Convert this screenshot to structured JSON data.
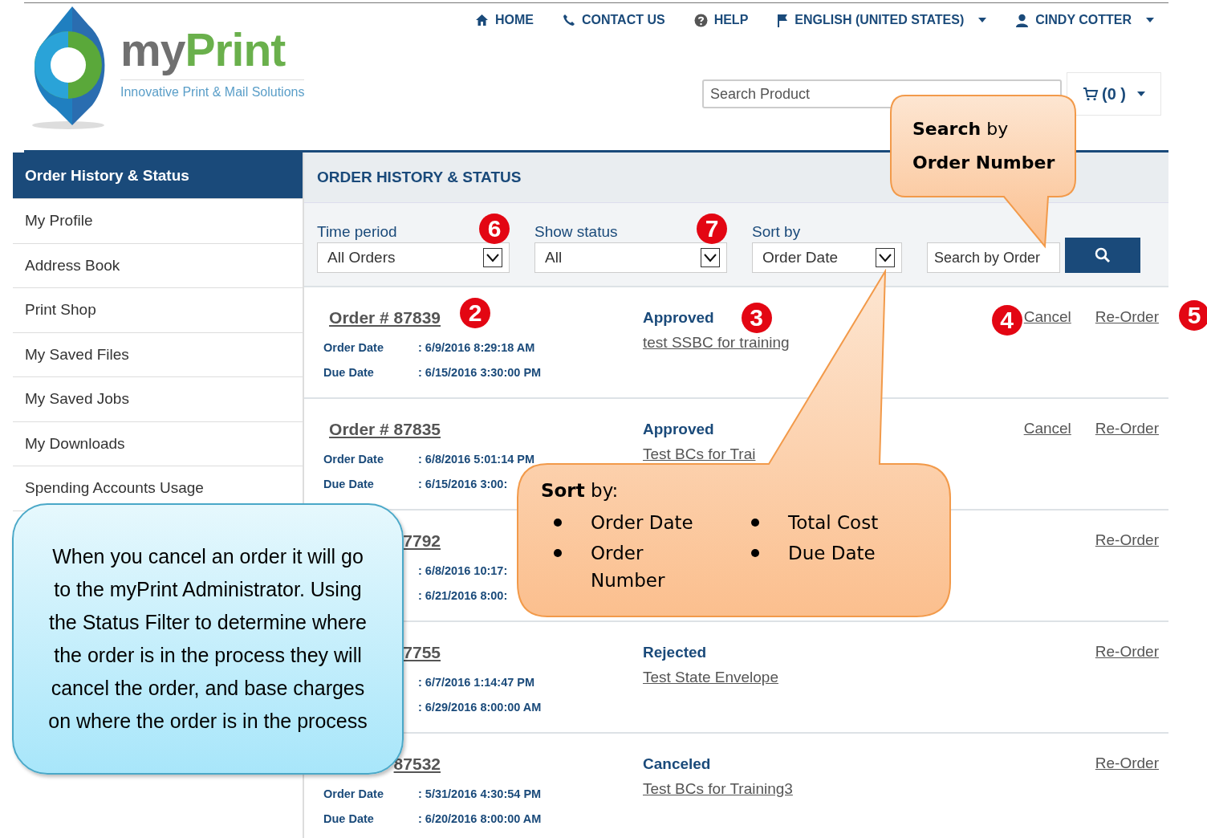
{
  "logo": {
    "wordmark": [
      "my",
      "Print"
    ],
    "tagline": "Innovative Print & Mail Solutions"
  },
  "nav": [
    {
      "kind": "home",
      "label": "HOME",
      "dropdown": false
    },
    {
      "kind": "phone",
      "label": "CONTACT US",
      "dropdown": false
    },
    {
      "kind": "help",
      "label": "HELP",
      "dropdown": false
    },
    {
      "kind": "flag",
      "label": "ENGLISH (UNITED STATES)",
      "dropdown": true
    },
    {
      "kind": "user",
      "label": "CINDY COTTER",
      "dropdown": true
    }
  ],
  "search": {
    "placeholder": "Search Product"
  },
  "cart": {
    "count": "(0 )"
  },
  "sidebar": {
    "items": [
      {
        "label": "Order History & Status",
        "selected": true
      },
      {
        "label": "My Profile",
        "selected": false
      },
      {
        "label": "Address Book",
        "selected": false
      },
      {
        "label": "Print Shop",
        "selected": false
      },
      {
        "label": "My Saved Files",
        "selected": false
      },
      {
        "label": "My Saved Jobs",
        "selected": false
      },
      {
        "label": "My Downloads",
        "selected": false
      },
      {
        "label": "Spending Accounts Usage",
        "selected": false
      }
    ]
  },
  "panel_title": "ORDER HISTORY & STATUS",
  "filters": [
    {
      "label": "Time period",
      "value": "All Orders",
      "badge": "6"
    },
    {
      "label": "Show status",
      "value": "All",
      "badge": "7"
    },
    {
      "label": "Sort by",
      "value": "Order Date"
    }
  ],
  "order_search": {
    "placeholder": "Search by Order"
  },
  "orders": [
    {
      "number": "Order # 87839",
      "number_badge": "2",
      "order_date_label": "Order Date",
      "order_date": ": 6/9/2016 8:29:18 AM",
      "due_date_label": "Due Date",
      "due_date": ": 6/15/2016 3:30:00 PM",
      "status": "Approved",
      "status_badge": "3",
      "product": "test SSBC for training",
      "cancel": "Cancel",
      "cancel_badge": "4",
      "reorder": "Re-Order",
      "reorder_badge": "5"
    },
    {
      "number": "Order # 87835",
      "order_date_label": "Order Date",
      "order_date": ": 6/8/2016 5:01:14 PM",
      "due_date_label": "Due Date",
      "due_date": ": 6/15/2016 3:00:",
      "status": "Approved",
      "product": "Test BCs for Trai",
      "cancel": "Cancel",
      "reorder": "Re-Order"
    },
    {
      "number": "7792",
      "order_date": ": 6/8/2016 10:17:",
      "due_date": ": 6/21/2016 8:00:",
      "reorder": "Re-Order"
    },
    {
      "number": "7755",
      "order_date": ": 6/7/2016 1:14:47 PM",
      "due_date": ": 6/29/2016 8:00:00 AM",
      "status": "Rejected",
      "product": "Test State Envelope",
      "reorder": "Re-Order"
    },
    {
      "number": "87532",
      "order_date_label": "Order Date",
      "order_date": ": 5/31/2016 4:30:54 PM",
      "due_date_label": "Due Date",
      "due_date": ": 6/20/2016 8:00:00 AM",
      "status": "Canceled",
      "product": "Test BCs for Training3",
      "reorder": "Re-Order"
    }
  ],
  "callouts": {
    "search_note": "**Search** by **Order Number**",
    "sort_note": {
      "title": "**Sort** by:",
      "items": [
        "Order Date",
        "Order Number",
        "Total Cost",
        "Due Date"
      ]
    },
    "cancel_note": "When you cancel an order it will go to the myPrint Administrator. Using the Status Filter to determine where the order is in the process they will cancel the order, and base charges on where the order is in the process"
  }
}
